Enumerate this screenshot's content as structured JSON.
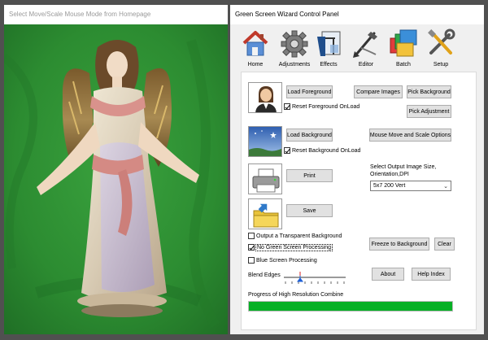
{
  "left_window": {
    "title": "Select Move/Scale Mouse Mode from Homepage"
  },
  "right_window": {
    "title": "Green Screen Wizard Control Panel"
  },
  "toolbar": {
    "items": [
      {
        "label": "Home",
        "icon": "house-icon"
      },
      {
        "label": "Adjustments",
        "icon": "gear-icon"
      },
      {
        "label": "Effects",
        "icon": "effects-icon"
      },
      {
        "label": "Editor",
        "icon": "brush-icon"
      },
      {
        "label": "Batch",
        "icon": "stacked-pictures-icon"
      },
      {
        "label": "Setup",
        "icon": "tools-icon"
      }
    ]
  },
  "panel": {
    "load_foreground": "Load Foreground",
    "compare_images": "Compare Images",
    "pick_background": "Pick Background",
    "reset_foreground": "Reset Foreground OnLoad",
    "pick_adjustment": "Pick Adjustment",
    "load_background": "Load Background",
    "mouse_move_scale": "Mouse Move and Scale Options",
    "reset_background": "Reset Background OnLoad",
    "print": "Print",
    "output_size_label": "Select Output Image Size, Orientation,DPI",
    "output_size_value": "5x7 200 Vert",
    "save": "Save",
    "transparent_bg": "Output a Transparent Background",
    "no_green_screen": "No Green Screen Processing",
    "blue_screen": "Blue Screen Processing",
    "freeze_background": "Freeze to Background",
    "clear": "Clear",
    "blend_edges": "Blend Edges",
    "about": "About",
    "help_index": "Help Index",
    "progress_label": "Progress of High Resolution Combine",
    "progress_value": 1.0
  },
  "colors": {
    "progress_fill": "#06b025",
    "green_screen": "#2e8f33"
  }
}
